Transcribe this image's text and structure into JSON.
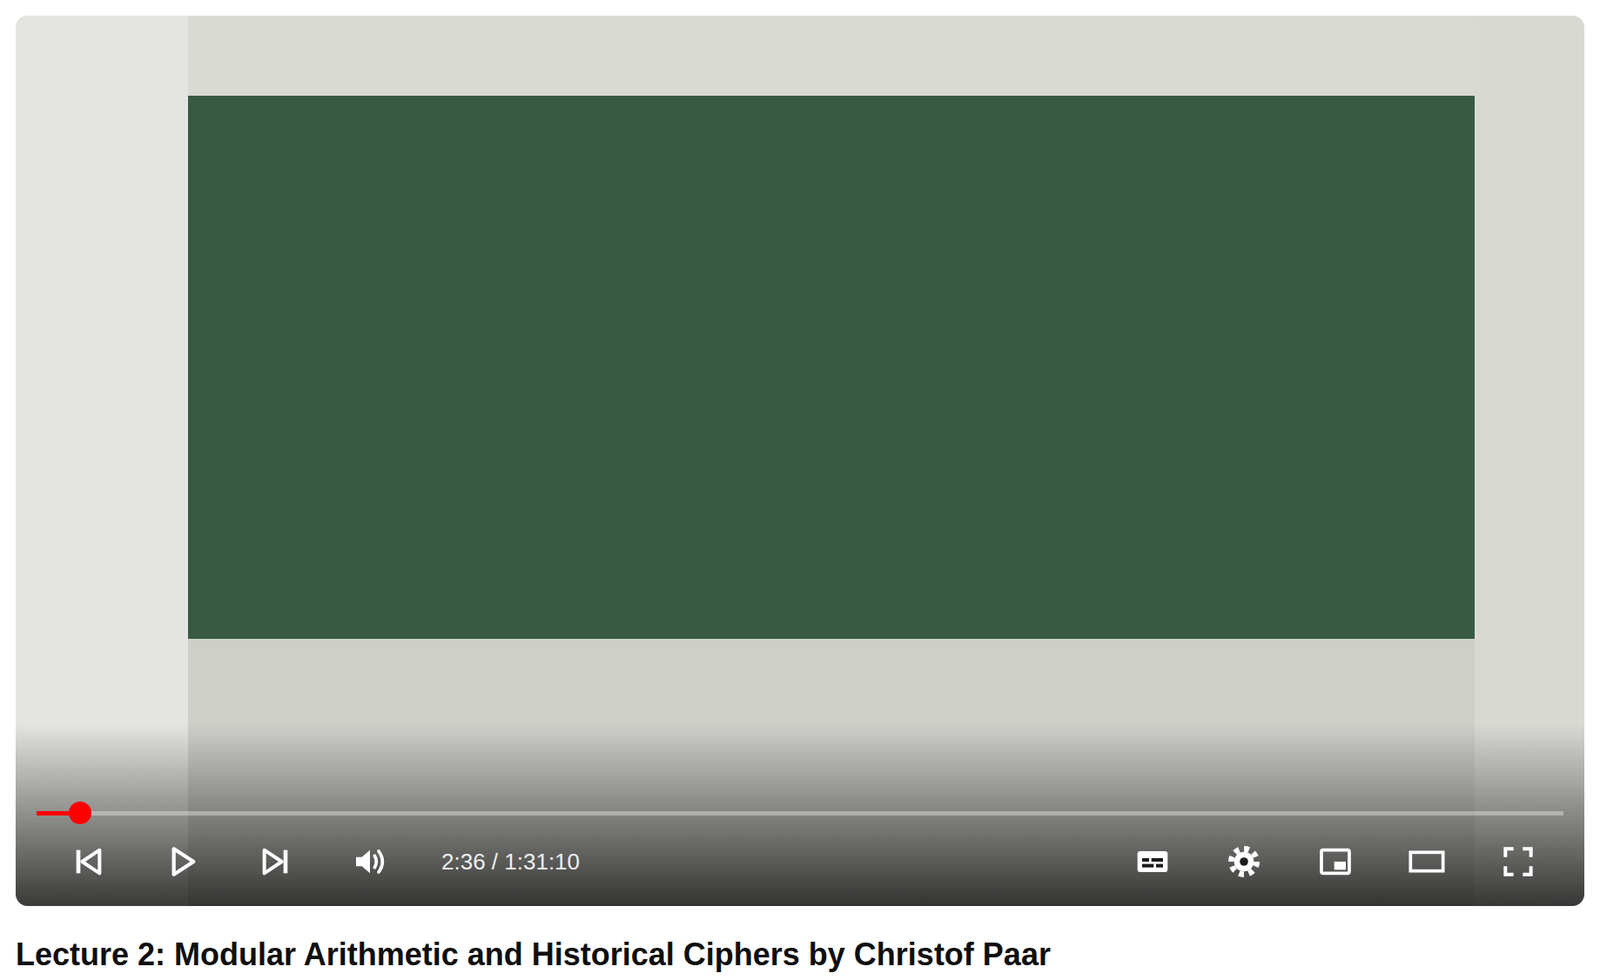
{
  "player": {
    "playing": false,
    "muted": false,
    "captions_on": false,
    "level": 0.0285,
    "time": "2:36 / 1:31:10"
  },
  "video": {
    "title": "Lecture 2: Modular Arithmetic and Historical Ciphers by Christof Paar"
  }
}
